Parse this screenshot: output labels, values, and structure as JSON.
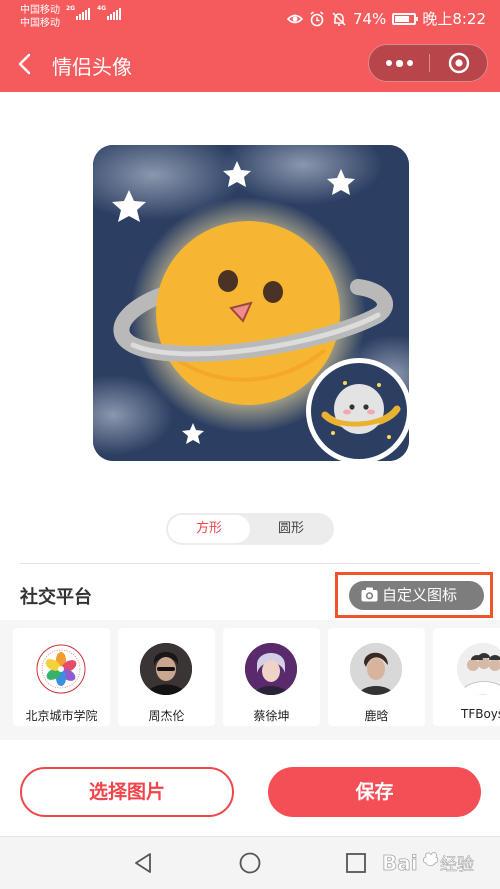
{
  "status_bar": {
    "carrier_1": "中国移动",
    "carrier_2": "中国移动",
    "net_1": "2G",
    "net_2": "4G",
    "battery": "74%",
    "time": "晚上8:22"
  },
  "header": {
    "title": "情侣头像",
    "background": "#f55a5c",
    "more_icon": "more-dots-icon",
    "close_icon": "target-icon"
  },
  "shape_toggle": {
    "options": [
      "方形",
      "圆形"
    ],
    "selected": "方形",
    "accent": "#f0464b"
  },
  "social": {
    "title": "社交平台",
    "custom_icon_label": "自定义图标",
    "custom_icon": "camera-icon",
    "items": [
      {
        "name": "北京城市学院"
      },
      {
        "name": "周杰伦"
      },
      {
        "name": "蔡徐坤"
      },
      {
        "name": "鹿晗"
      },
      {
        "name": "TFBoys"
      }
    ]
  },
  "actions": {
    "pick_label": "选择图片",
    "save_label": "保存"
  },
  "watermark": {
    "text": "Baidu经验"
  }
}
